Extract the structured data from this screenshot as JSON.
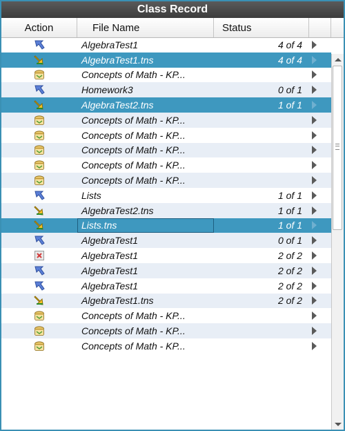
{
  "title": "Class Record",
  "columns": {
    "action": "Action",
    "file_name": "File Name",
    "status": "Status"
  },
  "rows": [
    {
      "action_icon": "arrow-blue-icon",
      "name": "AlgebraTest1",
      "status": "4 of 4"
    },
    {
      "action_icon": "arrow-yellow-icon",
      "name": "AlgebraTest1.tns",
      "status": "4 of 4",
      "selected": true
    },
    {
      "action_icon": "basket-icon",
      "name": "Concepts of Math - KP...",
      "status": ""
    },
    {
      "action_icon": "arrow-blue-icon",
      "name": "Homework3",
      "status": "0 of 1"
    },
    {
      "action_icon": "arrow-yellow-icon",
      "name": "AlgebraTest2.tns",
      "status": "1 of 1",
      "selected": true
    },
    {
      "action_icon": "basket-icon",
      "name": "Concepts of Math - KP...",
      "status": ""
    },
    {
      "action_icon": "basket-icon",
      "name": "Concepts of Math - KP...",
      "status": ""
    },
    {
      "action_icon": "basket-icon",
      "name": "Concepts of Math - KP...",
      "status": ""
    },
    {
      "action_icon": "basket-icon",
      "name": "Concepts of Math - KP...",
      "status": ""
    },
    {
      "action_icon": "basket-icon",
      "name": "Concepts of Math - KP...",
      "status": ""
    },
    {
      "action_icon": "arrow-blue-icon",
      "name": "Lists",
      "status": "1 of 1"
    },
    {
      "action_icon": "arrow-yellow-icon",
      "name": "AlgebraTest2.tns",
      "status": "1 of 1"
    },
    {
      "action_icon": "arrow-yellow-icon",
      "name": "Lists.tns",
      "status": "1 of 1",
      "selected": true,
      "focused": true
    },
    {
      "action_icon": "arrow-blue-icon",
      "name": "AlgebraTest1",
      "status": "0 of 1"
    },
    {
      "action_icon": "delete-icon",
      "name": "AlgebraTest1",
      "status": "2 of 2"
    },
    {
      "action_icon": "arrow-blue-icon",
      "name": "AlgebraTest1",
      "status": "2 of 2"
    },
    {
      "action_icon": "arrow-blue-icon",
      "name": "AlgebraTest1",
      "status": "2 of 2"
    },
    {
      "action_icon": "arrow-yellow-icon",
      "name": "AlgebraTest1.tns",
      "status": "2 of 2"
    },
    {
      "action_icon": "basket-icon",
      "name": "Concepts of Math - KP...",
      "status": ""
    },
    {
      "action_icon": "basket-icon",
      "name": "Concepts of Math - KP...",
      "status": ""
    },
    {
      "action_icon": "basket-icon",
      "name": "Concepts of Math - KP...",
      "status": ""
    }
  ],
  "colors": {
    "selection": "#3e98bf",
    "border": "#3a90b4",
    "alt_row": "#e8eef6"
  }
}
